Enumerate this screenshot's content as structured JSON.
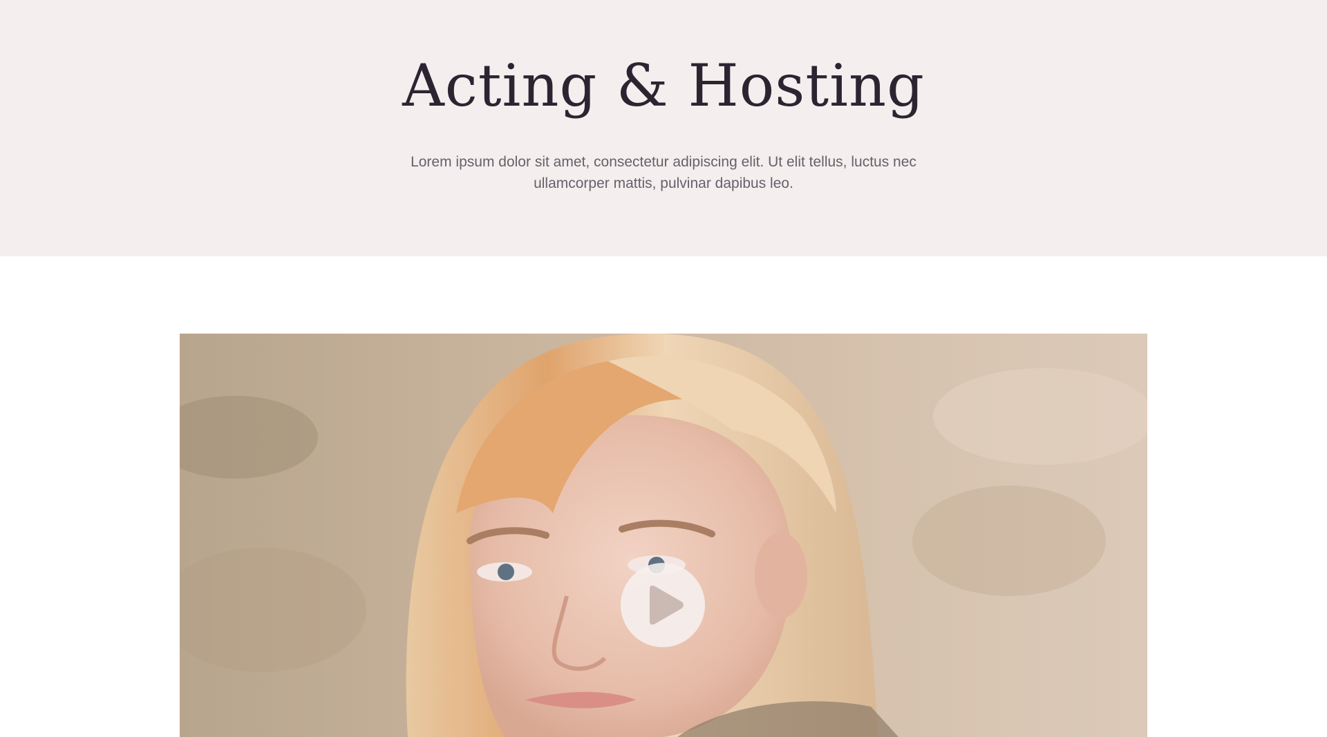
{
  "hero": {
    "title": "Acting & Hosting",
    "subtitle": "Lorem ipsum dolor sit amet, consectetur adipiscing elit. Ut elit tellus, luctus nec ullamcorper mattis, pulvinar dapibus leo."
  },
  "video": {
    "play_icon": "play-icon"
  },
  "colors": {
    "hero_background": "#f4eeee",
    "title": "#2b2532",
    "subtitle": "#66606a",
    "page_background": "#ffffff"
  }
}
